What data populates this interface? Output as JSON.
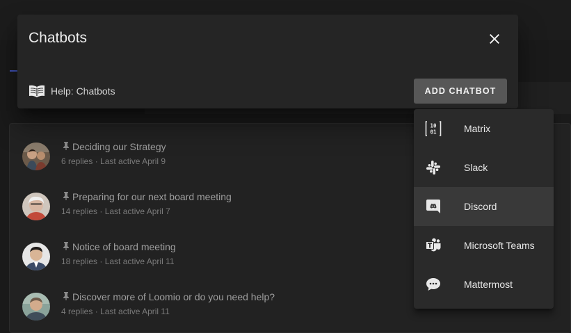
{
  "dialog": {
    "title": "Chatbots",
    "help_label": "Help: Chatbots",
    "add_button": "ADD CHATBOT"
  },
  "menu": {
    "items": [
      {
        "label": "Matrix",
        "icon": "matrix-icon"
      },
      {
        "label": "Slack",
        "icon": "slack-icon"
      },
      {
        "label": "Discord",
        "icon": "discord-icon",
        "highlighted": true
      },
      {
        "label": "Microsoft Teams",
        "icon": "microsoft-teams-icon"
      },
      {
        "label": "Mattermost",
        "icon": "mattermost-icon"
      }
    ]
  },
  "threads": [
    {
      "title": "Deciding our Strategy",
      "replies": "6 replies",
      "last_active": "· Last active April 9"
    },
    {
      "title": "Preparing for our next board meeting",
      "replies": "14 replies",
      "last_active": "· Last active April 7"
    },
    {
      "title": "Notice of board meeting",
      "replies": "18 replies",
      "last_active": "· Last active April 11"
    },
    {
      "title": "Discover more of Loomio or do you need help?",
      "replies": "4 replies",
      "last_active": "· Last active April 11"
    }
  ],
  "colors": {
    "background": "#1a1a1a",
    "dialog": "#252525",
    "menu": "#2a2a2a",
    "menu_highlight": "#393939",
    "button": "#575757"
  }
}
